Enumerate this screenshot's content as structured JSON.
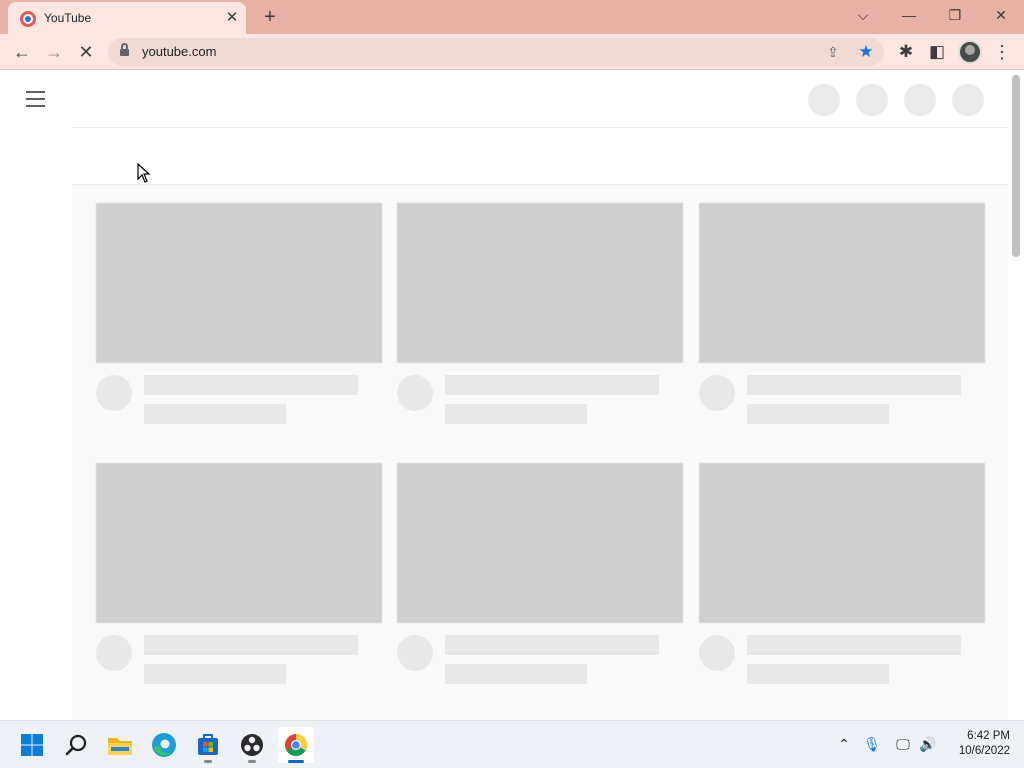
{
  "browser": {
    "tab": {
      "title": "YouTube",
      "close_glyph": "✕"
    },
    "new_tab_glyph": "+",
    "window_controls": {
      "dropdown": "⌵",
      "minimize": "—",
      "restore": "❐",
      "close": "✕"
    },
    "toolbar": {
      "back_glyph": "←",
      "forward_glyph": "→",
      "stop_glyph": "✕",
      "url": "youtube.com",
      "share_glyph": "⇪",
      "star_glyph": "★",
      "extensions_glyph": "✱",
      "sidepanel_glyph": "◧",
      "menu_glyph": "⋮"
    }
  },
  "page": {
    "state": "loading-skeleton",
    "skeleton_cards": 6,
    "colors": {
      "skeleton_thumb": "#cfcfcf",
      "skeleton_line": "#e8e8e8",
      "content_bg": "#f9f9f9"
    }
  },
  "taskbar": {
    "apps": [
      {
        "name": "start",
        "icon": "windows-logo"
      },
      {
        "name": "search",
        "icon": "search-icon"
      },
      {
        "name": "file-explorer",
        "icon": "folder-icon"
      },
      {
        "name": "edge",
        "icon": "edge-icon"
      },
      {
        "name": "microsoft-store",
        "icon": "store-icon"
      },
      {
        "name": "obs-studio",
        "icon": "obs-icon"
      },
      {
        "name": "chrome",
        "icon": "chrome-icon",
        "active": true
      }
    ],
    "tray": {
      "chevron": "⌃",
      "mic": "🎙",
      "network": "🖵",
      "volume": "🔊"
    },
    "clock": {
      "time": "6:42 PM",
      "date": "10/6/2022"
    }
  }
}
